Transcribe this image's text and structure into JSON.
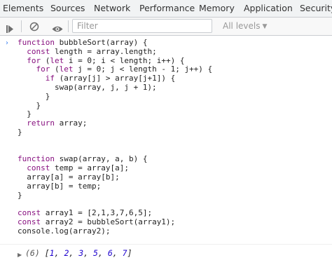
{
  "tabs": [
    "Elements",
    "Sources",
    "Network",
    "Performance",
    "Memory",
    "Application",
    "Security"
  ],
  "toolbar": {
    "filter_placeholder": "Filter",
    "levels_label": "All levels",
    "icons": [
      "play-icon",
      "clear-console-icon",
      "eye-icon",
      "chevron-down-icon"
    ]
  },
  "console": {
    "prompt_glyph": "›",
    "code_lines": [
      "function bubbleSort(array) {",
      "  const length = array.length;",
      "  for (let i = 0; i < length; i++) {",
      "    for (let j = 0; j < length - 1; j++) {",
      "      if (array[j] > array[j+1]) {",
      "        swap(array, j, j + 1);",
      "      }",
      "    }",
      "  }",
      "  return array;",
      "}",
      "",
      "",
      "function swap(array, a, b) {",
      "  const temp = array[a];",
      "  array[a] = array[b];",
      "  array[b] = temp;",
      "}",
      "",
      "const array1 = [2,1,3,7,6,5];",
      "const array2 = bubbleSort(array1);",
      "console.log(array2);"
    ],
    "result": {
      "count": "(6)",
      "values": [
        "1",
        "2",
        "3",
        "5",
        "6",
        "7"
      ]
    }
  },
  "colors": {
    "keyword": "#881280",
    "prompt": "#367cf1",
    "number": "#1c00cf",
    "tabbar_bg": "#f1f3f4"
  }
}
